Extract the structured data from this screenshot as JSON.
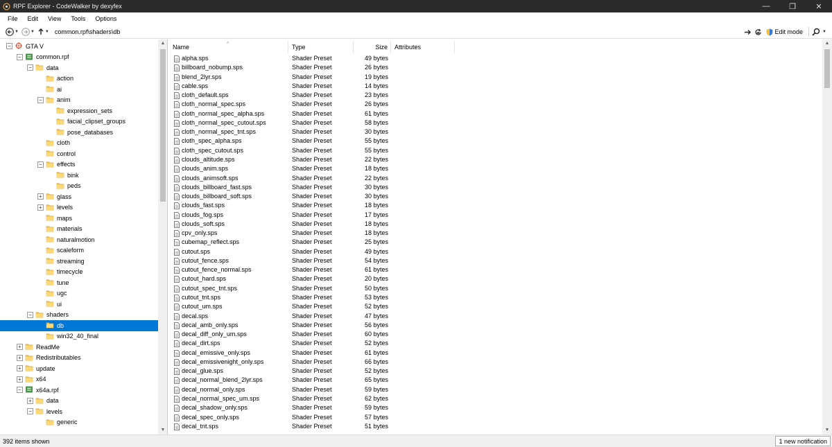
{
  "window": {
    "title": "RPF Explorer - CodeWalker by dexyfex",
    "minimize": "—",
    "maximize": "❐",
    "close": "✕"
  },
  "menu": [
    "File",
    "Edit",
    "View",
    "Tools",
    "Options"
  ],
  "toolbar": {
    "path": "common.rpf\\shaders\\db",
    "edit_mode_label": "Edit mode",
    "back_icon": "back-arrow-icon",
    "forward_icon": "forward-arrow-icon",
    "up_icon": "up-arrow-icon",
    "go_icon": "go-arrow-icon",
    "refresh_icon": "refresh-icon",
    "search_icon": "search-icon"
  },
  "tree": [
    {
      "label": "GTA V",
      "level": 0,
      "expander": "-",
      "icon": "gta"
    },
    {
      "label": "common.rpf",
      "level": 1,
      "expander": "-",
      "icon": "rpf"
    },
    {
      "label": "data",
      "level": 2,
      "expander": "-",
      "icon": "folder"
    },
    {
      "label": "action",
      "level": 3,
      "expander": "",
      "icon": "folder"
    },
    {
      "label": "ai",
      "level": 3,
      "expander": "",
      "icon": "folder"
    },
    {
      "label": "anim",
      "level": 3,
      "expander": "-",
      "icon": "folder"
    },
    {
      "label": "expression_sets",
      "level": 4,
      "expander": "",
      "icon": "folder"
    },
    {
      "label": "facial_clipset_groups",
      "level": 4,
      "expander": "",
      "icon": "folder"
    },
    {
      "label": "pose_databases",
      "level": 4,
      "expander": "",
      "icon": "folder"
    },
    {
      "label": "cloth",
      "level": 3,
      "expander": "",
      "icon": "folder"
    },
    {
      "label": "control",
      "level": 3,
      "expander": "",
      "icon": "folder"
    },
    {
      "label": "effects",
      "level": 3,
      "expander": "-",
      "icon": "folder"
    },
    {
      "label": "bink",
      "level": 4,
      "expander": "",
      "icon": "folder"
    },
    {
      "label": "peds",
      "level": 4,
      "expander": "",
      "icon": "folder"
    },
    {
      "label": "glass",
      "level": 3,
      "expander": "+",
      "icon": "folder"
    },
    {
      "label": "levels",
      "level": 3,
      "expander": "+",
      "icon": "folder"
    },
    {
      "label": "maps",
      "level": 3,
      "expander": "",
      "icon": "folder"
    },
    {
      "label": "materials",
      "level": 3,
      "expander": "",
      "icon": "folder"
    },
    {
      "label": "naturalmotion",
      "level": 3,
      "expander": "",
      "icon": "folder"
    },
    {
      "label": "scaleform",
      "level": 3,
      "expander": "",
      "icon": "folder"
    },
    {
      "label": "streaming",
      "level": 3,
      "expander": "",
      "icon": "folder"
    },
    {
      "label": "timecycle",
      "level": 3,
      "expander": "",
      "icon": "folder"
    },
    {
      "label": "tune",
      "level": 3,
      "expander": "",
      "icon": "folder"
    },
    {
      "label": "ugc",
      "level": 3,
      "expander": "",
      "icon": "folder"
    },
    {
      "label": "ui",
      "level": 3,
      "expander": "",
      "icon": "folder"
    },
    {
      "label": "shaders",
      "level": 2,
      "expander": "-",
      "icon": "folder"
    },
    {
      "label": "db",
      "level": 3,
      "expander": "",
      "icon": "folder",
      "selected": true
    },
    {
      "label": "win32_40_final",
      "level": 3,
      "expander": "",
      "icon": "folder"
    },
    {
      "label": "ReadMe",
      "level": 1,
      "expander": "+",
      "icon": "folder"
    },
    {
      "label": "Redistributables",
      "level": 1,
      "expander": "+",
      "icon": "folder"
    },
    {
      "label": "update",
      "level": 1,
      "expander": "+",
      "icon": "folder"
    },
    {
      "label": "x64",
      "level": 1,
      "expander": "+",
      "icon": "folder"
    },
    {
      "label": "x64a.rpf",
      "level": 1,
      "expander": "-",
      "icon": "rpf"
    },
    {
      "label": "data",
      "level": 2,
      "expander": "+",
      "icon": "folder"
    },
    {
      "label": "levels",
      "level": 2,
      "expander": "-",
      "icon": "folder"
    },
    {
      "label": "generic",
      "level": 3,
      "expander": "",
      "icon": "folder"
    }
  ],
  "columns": {
    "name": "Name",
    "type": "Type",
    "size": "Size",
    "attributes": "Attributes"
  },
  "files": [
    {
      "name": "alpha.sps",
      "type": "Shader Preset",
      "size": "49 bytes"
    },
    {
      "name": "billboard_nobump.sps",
      "type": "Shader Preset",
      "size": "26 bytes"
    },
    {
      "name": "blend_2lyr.sps",
      "type": "Shader Preset",
      "size": "19 bytes"
    },
    {
      "name": "cable.sps",
      "type": "Shader Preset",
      "size": "14 bytes"
    },
    {
      "name": "cloth_default.sps",
      "type": "Shader Preset",
      "size": "23 bytes"
    },
    {
      "name": "cloth_normal_spec.sps",
      "type": "Shader Preset",
      "size": "26 bytes"
    },
    {
      "name": "cloth_normal_spec_alpha.sps",
      "type": "Shader Preset",
      "size": "61 bytes"
    },
    {
      "name": "cloth_normal_spec_cutout.sps",
      "type": "Shader Preset",
      "size": "58 bytes"
    },
    {
      "name": "cloth_normal_spec_tnt.sps",
      "type": "Shader Preset",
      "size": "30 bytes"
    },
    {
      "name": "cloth_spec_alpha.sps",
      "type": "Shader Preset",
      "size": "55 bytes"
    },
    {
      "name": "cloth_spec_cutout.sps",
      "type": "Shader Preset",
      "size": "55 bytes"
    },
    {
      "name": "clouds_altitude.sps",
      "type": "Shader Preset",
      "size": "22 bytes"
    },
    {
      "name": "clouds_anim.sps",
      "type": "Shader Preset",
      "size": "18 bytes"
    },
    {
      "name": "clouds_animsoft.sps",
      "type": "Shader Preset",
      "size": "22 bytes"
    },
    {
      "name": "clouds_billboard_fast.sps",
      "type": "Shader Preset",
      "size": "30 bytes"
    },
    {
      "name": "clouds_billboard_soft.sps",
      "type": "Shader Preset",
      "size": "30 bytes"
    },
    {
      "name": "clouds_fast.sps",
      "type": "Shader Preset",
      "size": "18 bytes"
    },
    {
      "name": "clouds_fog.sps",
      "type": "Shader Preset",
      "size": "17 bytes"
    },
    {
      "name": "clouds_soft.sps",
      "type": "Shader Preset",
      "size": "18 bytes"
    },
    {
      "name": "cpv_only.sps",
      "type": "Shader Preset",
      "size": "18 bytes"
    },
    {
      "name": "cubemap_reflect.sps",
      "type": "Shader Preset",
      "size": "25 bytes"
    },
    {
      "name": "cutout.sps",
      "type": "Shader Preset",
      "size": "49 bytes"
    },
    {
      "name": "cutout_fence.sps",
      "type": "Shader Preset",
      "size": "54 bytes"
    },
    {
      "name": "cutout_fence_normal.sps",
      "type": "Shader Preset",
      "size": "61 bytes"
    },
    {
      "name": "cutout_hard.sps",
      "type": "Shader Preset",
      "size": "20 bytes"
    },
    {
      "name": "cutout_spec_tnt.sps",
      "type": "Shader Preset",
      "size": "50 bytes"
    },
    {
      "name": "cutout_tnt.sps",
      "type": "Shader Preset",
      "size": "53 bytes"
    },
    {
      "name": "cutout_um.sps",
      "type": "Shader Preset",
      "size": "52 bytes"
    },
    {
      "name": "decal.sps",
      "type": "Shader Preset",
      "size": "47 bytes"
    },
    {
      "name": "decal_amb_only.sps",
      "type": "Shader Preset",
      "size": "56 bytes"
    },
    {
      "name": "decal_diff_only_um.sps",
      "type": "Shader Preset",
      "size": "60 bytes"
    },
    {
      "name": "decal_dirt.sps",
      "type": "Shader Preset",
      "size": "52 bytes"
    },
    {
      "name": "decal_emissive_only.sps",
      "type": "Shader Preset",
      "size": "61 bytes"
    },
    {
      "name": "decal_emissivenight_only.sps",
      "type": "Shader Preset",
      "size": "66 bytes"
    },
    {
      "name": "decal_glue.sps",
      "type": "Shader Preset",
      "size": "52 bytes"
    },
    {
      "name": "decal_normal_blend_2lyr.sps",
      "type": "Shader Preset",
      "size": "65 bytes"
    },
    {
      "name": "decal_normal_only.sps",
      "type": "Shader Preset",
      "size": "59 bytes"
    },
    {
      "name": "decal_normal_spec_um.sps",
      "type": "Shader Preset",
      "size": "62 bytes"
    },
    {
      "name": "decal_shadow_only.sps",
      "type": "Shader Preset",
      "size": "59 bytes"
    },
    {
      "name": "decal_spec_only.sps",
      "type": "Shader Preset",
      "size": "57 bytes"
    },
    {
      "name": "decal_tnt.sps",
      "type": "Shader Preset",
      "size": "51 bytes"
    }
  ],
  "status": {
    "items_shown": "392 items shown",
    "notification": "1 new notification"
  },
  "colors": {
    "selection": "#0078d7",
    "titlebar": "#2b2b2b",
    "folder": "#f4c654"
  }
}
